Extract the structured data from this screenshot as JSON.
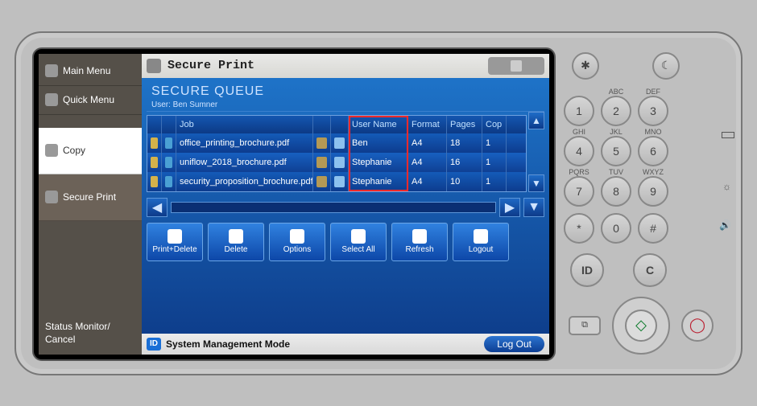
{
  "sidebar": {
    "items": [
      {
        "label": "Main Menu",
        "icon": "home-icon"
      },
      {
        "label": "Quick Menu",
        "icon": "quick-icon"
      },
      {
        "label": "Copy",
        "icon": "copy-icon"
      },
      {
        "label": "Secure Print",
        "icon": "secure-print-icon"
      }
    ],
    "status_monitor": "Status Monitor/\nCancel"
  },
  "titlebar": {
    "title": "Secure Print"
  },
  "panel": {
    "heading": "SECURE QUEUE",
    "user_label": "User: Ben Sumner"
  },
  "columns": {
    "job": "Job",
    "user": "User Name",
    "format": "Format",
    "pages": "Pages",
    "copies": "Cop"
  },
  "jobs": [
    {
      "job": "office_printing_brochure.pdf",
      "user": "Ben",
      "format": "A4",
      "pages": "18",
      "copies": "1"
    },
    {
      "job": "uniflow_2018_brochure.pdf",
      "user": "Stephanie",
      "format": "A4",
      "pages": "16",
      "copies": "1"
    },
    {
      "job": "security_proposition_brochure.pdf",
      "user": "Stephanie",
      "format": "A4",
      "pages": "10",
      "copies": "1"
    }
  ],
  "actions": {
    "print_delete": "Print+Delete",
    "delete": "Delete",
    "options": "Options",
    "select_all": "Select All",
    "refresh": "Refresh",
    "logout": "Logout"
  },
  "bottombar": {
    "mode": "System Management Mode",
    "logout": "Log Out",
    "id": "ID"
  },
  "keypad": {
    "letters": {
      "2": "ABC",
      "3": "DEF",
      "4": "GHI",
      "5": "JKL",
      "6": "MNO",
      "7": "PQRS",
      "8": "TUV",
      "9": "WXYZ"
    },
    "digits": [
      "1",
      "2",
      "3",
      "4",
      "5",
      "6",
      "7",
      "8",
      "9",
      "*",
      "0",
      "#"
    ],
    "id": "ID",
    "clear": "C"
  }
}
